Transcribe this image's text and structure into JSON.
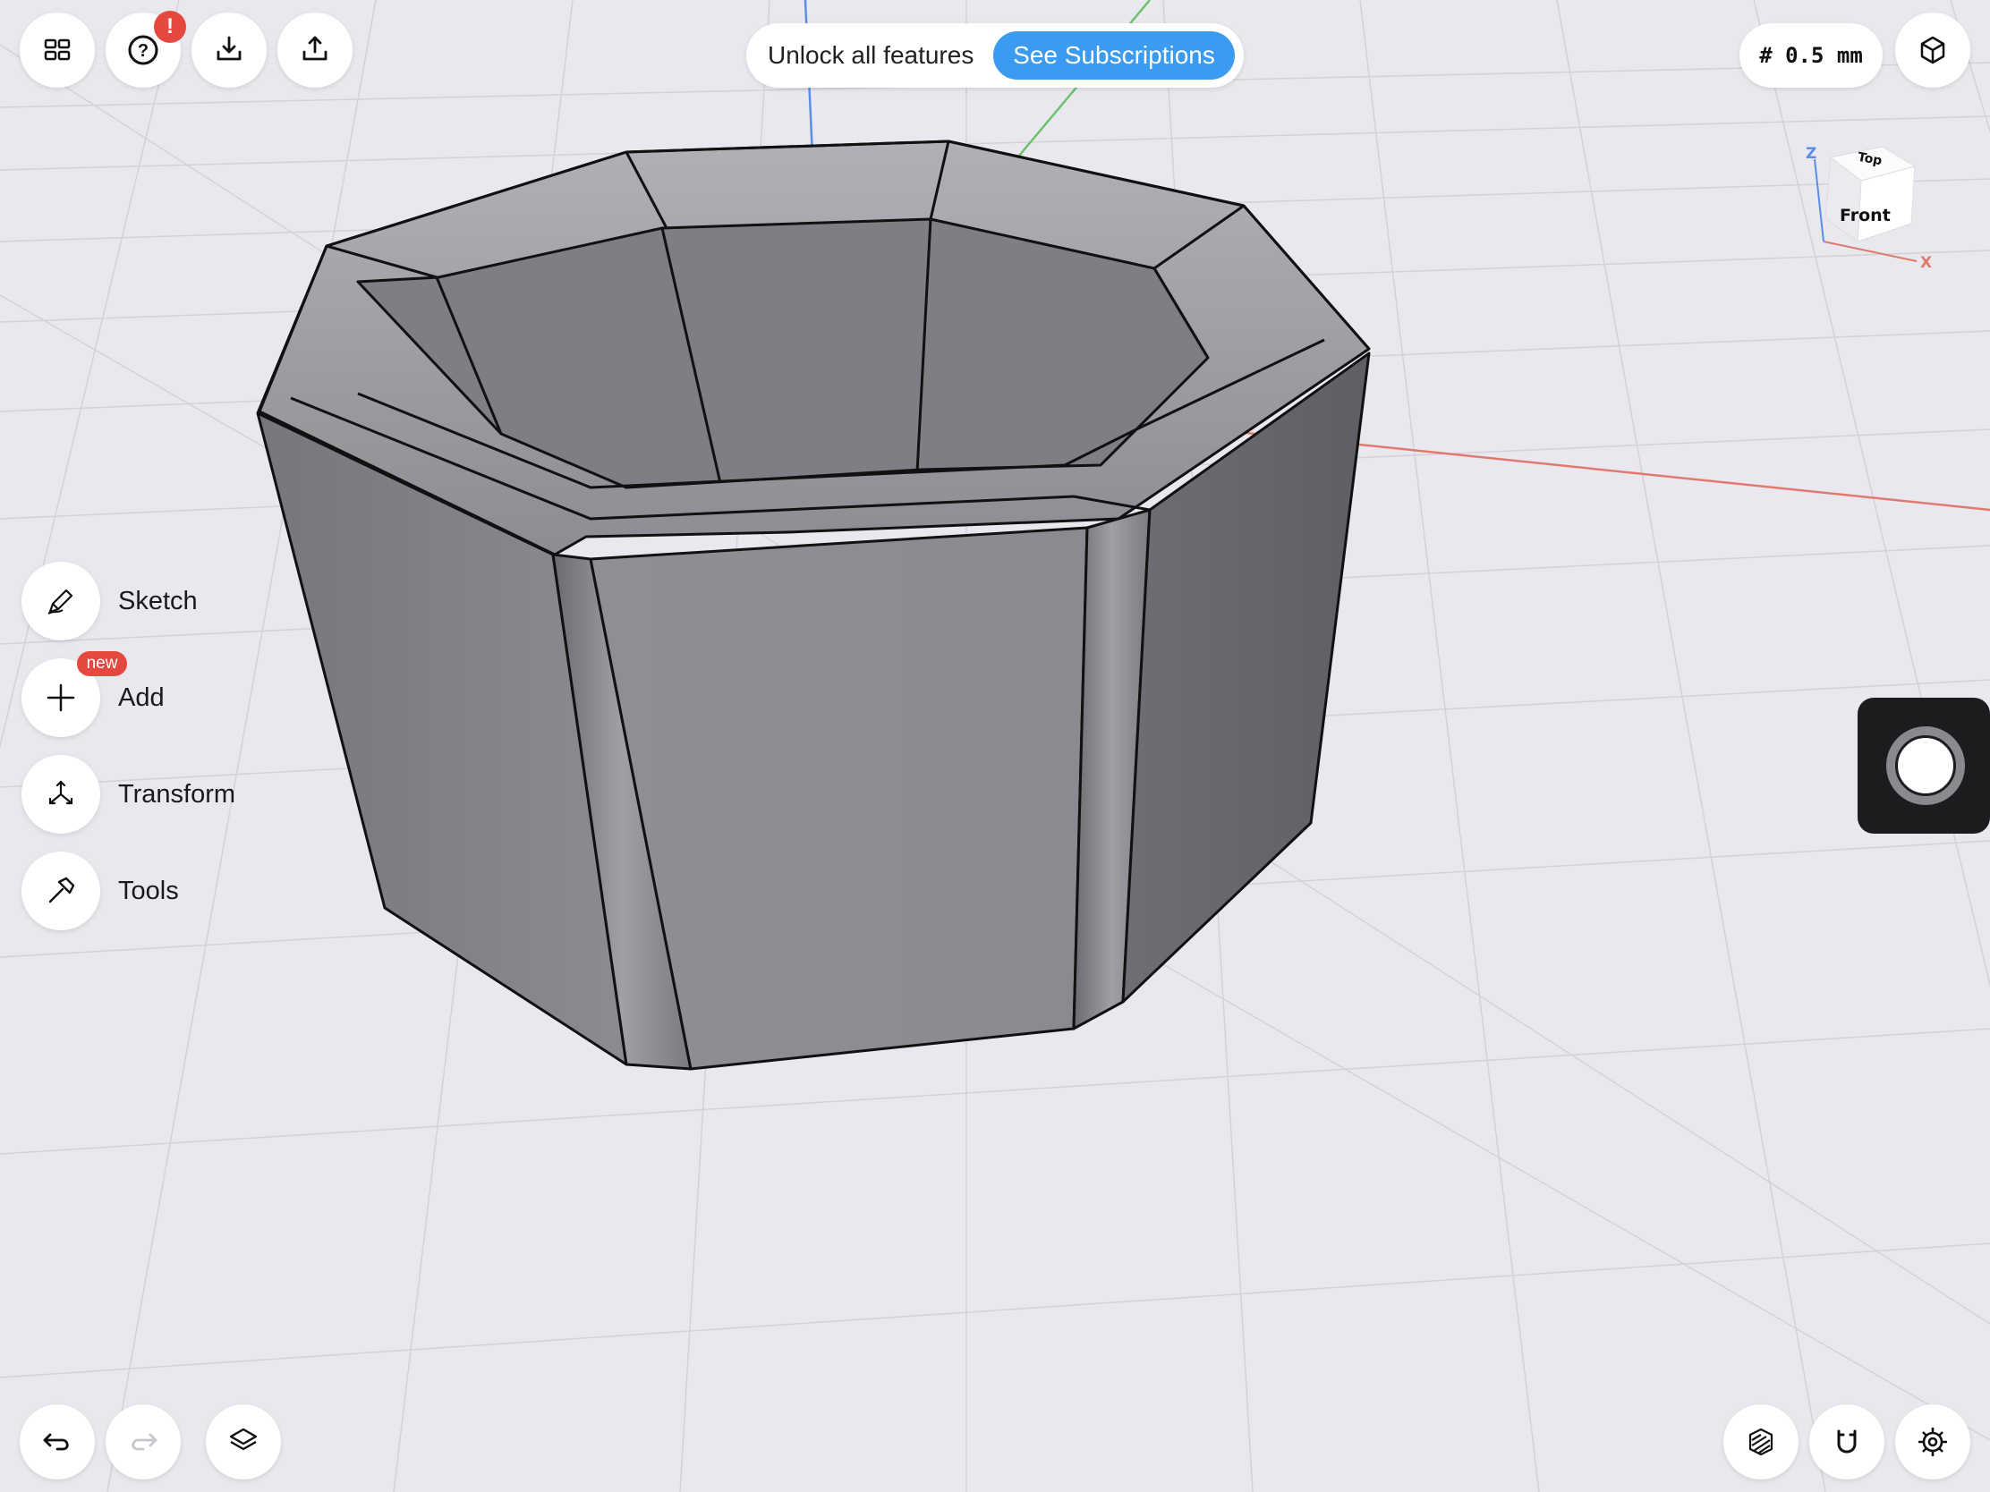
{
  "toolbar": {
    "items": [
      "grid-menu",
      "help",
      "import",
      "export"
    ],
    "help_badge": "!"
  },
  "promo": {
    "text": "Unlock all features",
    "button": "See Subscriptions"
  },
  "grid_size": {
    "label": "# 0.5 mm"
  },
  "view_cube": {
    "top": "Top",
    "front": "Front",
    "z_axis": "Z",
    "x_axis": "X"
  },
  "tools": [
    {
      "label": "Sketch",
      "icon": "pencil-icon"
    },
    {
      "label": "Add",
      "icon": "plus-icon",
      "badge": "new"
    },
    {
      "label": "Transform",
      "icon": "transform-icon"
    },
    {
      "label": "Tools",
      "icon": "hammer-icon"
    }
  ],
  "bottom_left": [
    "undo-icon",
    "redo-icon",
    "layers-icon"
  ],
  "bottom_right": [
    "section-view-icon",
    "snap-magnet-icon",
    "settings-gear-icon"
  ],
  "colors": {
    "background": "#e9e8ee",
    "accent": "#3a9bf0",
    "badge": "#e5483e",
    "model": "#8a8a90",
    "x_axis": "#e07a6e",
    "y_axis": "#6cc36c",
    "z_axis": "#5b8fe6"
  }
}
